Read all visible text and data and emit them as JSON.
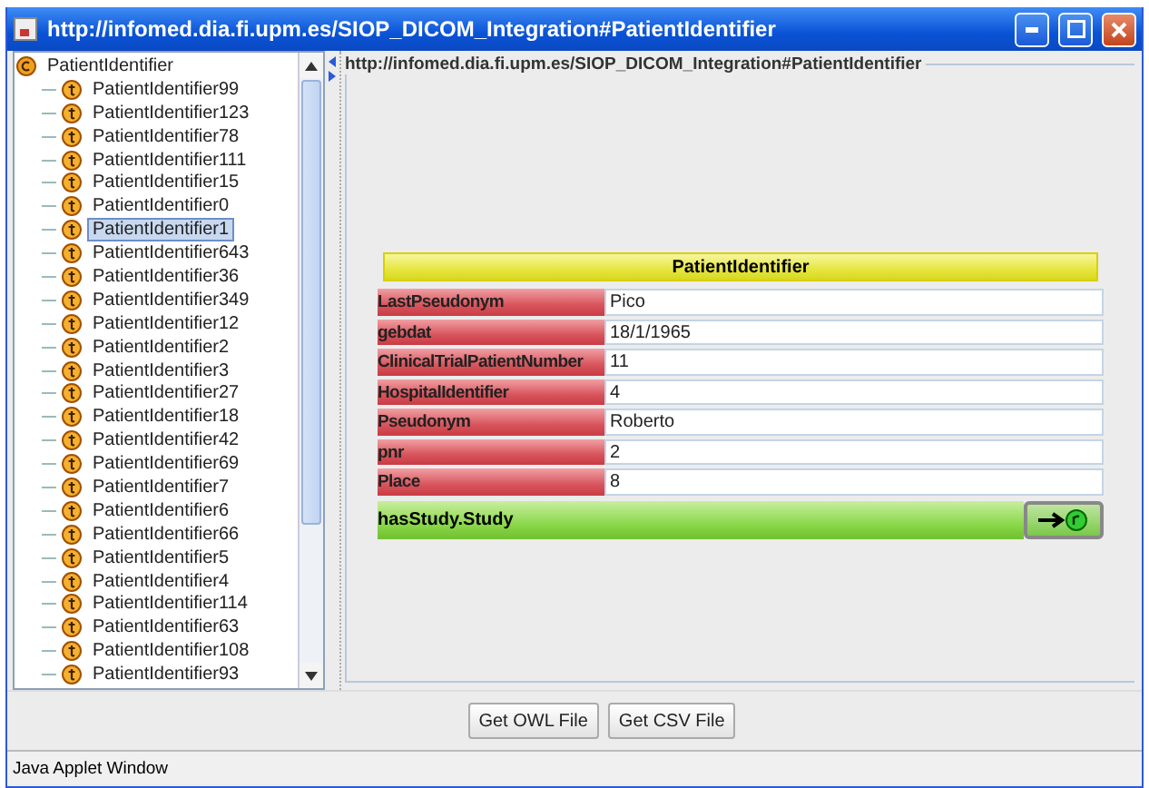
{
  "window": {
    "title": "http://infomed.dia.fi.upm.es/SIOP_DICOM_Integration#PatientIdentifier"
  },
  "tree": {
    "root": {
      "label": "PatientIdentifier",
      "children": [
        {
          "label": "PatientIdentifier99",
          "selected": false
        },
        {
          "label": "PatientIdentifier123",
          "selected": false
        },
        {
          "label": "PatientIdentifier78",
          "selected": false
        },
        {
          "label": "PatientIdentifier111",
          "selected": false
        },
        {
          "label": "PatientIdentifier15",
          "selected": false
        },
        {
          "label": "PatientIdentifier0",
          "selected": false
        },
        {
          "label": "PatientIdentifier1",
          "selected": true
        },
        {
          "label": "PatientIdentifier643",
          "selected": false
        },
        {
          "label": "PatientIdentifier36",
          "selected": false
        },
        {
          "label": "PatientIdentifier349",
          "selected": false
        },
        {
          "label": "PatientIdentifier12",
          "selected": false
        },
        {
          "label": "PatientIdentifier2",
          "selected": false
        },
        {
          "label": "PatientIdentifier3",
          "selected": false
        },
        {
          "label": "PatientIdentifier27",
          "selected": false
        },
        {
          "label": "PatientIdentifier18",
          "selected": false
        },
        {
          "label": "PatientIdentifier42",
          "selected": false
        },
        {
          "label": "PatientIdentifier69",
          "selected": false
        },
        {
          "label": "PatientIdentifier7",
          "selected": false
        },
        {
          "label": "PatientIdentifier6",
          "selected": false
        },
        {
          "label": "PatientIdentifier66",
          "selected": false
        },
        {
          "label": "PatientIdentifier5",
          "selected": false
        },
        {
          "label": "PatientIdentifier4",
          "selected": false
        },
        {
          "label": "PatientIdentifier114",
          "selected": false
        },
        {
          "label": "PatientIdentifier63",
          "selected": false
        },
        {
          "label": "PatientIdentifier108",
          "selected": false
        },
        {
          "label": "PatientIdentifier93",
          "selected": false
        }
      ]
    }
  },
  "detail": {
    "border_title": "http://infomed.dia.fi.upm.es/SIOP_DICOM_Integration#PatientIdentifier",
    "card": {
      "title": "PatientIdentifier",
      "properties": [
        {
          "kind": "data",
          "name": "LastPseudonym",
          "value": "Pico"
        },
        {
          "kind": "data",
          "name": "gebdat",
          "value": "18/1/1965"
        },
        {
          "kind": "data",
          "name": "ClinicalTrialPatientNumber",
          "value": "11"
        },
        {
          "kind": "data",
          "name": "HospitalIdentifier",
          "value": "4"
        },
        {
          "kind": "data",
          "name": "Pseudonym",
          "value": "Roberto"
        },
        {
          "kind": "data",
          "name": "pnr",
          "value": "2"
        },
        {
          "kind": "data",
          "name": "Place",
          "value": "8"
        },
        {
          "kind": "object",
          "name": "hasStudy.Study"
        }
      ]
    }
  },
  "buttons": [
    "Get OWL File",
    "Get CSV File"
  ],
  "status_bar": "Java Applet Window"
}
